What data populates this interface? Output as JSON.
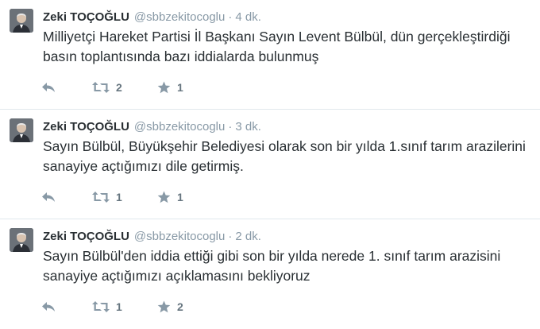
{
  "colors": {
    "name": "#292f33",
    "muted": "#8899a6",
    "separator": "#e1e8ed",
    "action_icon": "#8899a6"
  },
  "tweets": [
    {
      "fullname": "Zeki TOÇOĞLU",
      "username": "@sbbzekitocoglu",
      "dot": "·",
      "time": "4 dk.",
      "text": "Milliyetçi Hareket Partisi İl Başkanı Sayın Levent Bülbül, dün gerçekleştirdiği basın toplantısında bazı iddialarda bulunmuş",
      "retweets": "2",
      "favorites": "1"
    },
    {
      "fullname": "Zeki TOÇOĞLU",
      "username": "@sbbzekitocoglu",
      "dot": "·",
      "time": "3 dk.",
      "text": "Sayın Bülbül, Büyükşehir Belediyesi olarak son bir yılda 1.sınıf tarım arazilerini sanayiye açtığımızı dile getirmiş.",
      "retweets": "1",
      "favorites": "1"
    },
    {
      "fullname": "Zeki TOÇOĞLU",
      "username": "@sbbzekitocoglu",
      "dot": "·",
      "time": "2 dk.",
      "text": "Sayın Bülbül'den iddia ettiği gibi son bir yılda nerede 1. sınıf tarım arazisini sanayiye açtığımızı açıklamasını bekliyoruz",
      "retweets": "1",
      "favorites": "2"
    }
  ],
  "icons": {
    "avatar": "profile-photo",
    "reply": "reply-icon",
    "retweet": "retweet-icon",
    "favorite": "star-icon"
  }
}
